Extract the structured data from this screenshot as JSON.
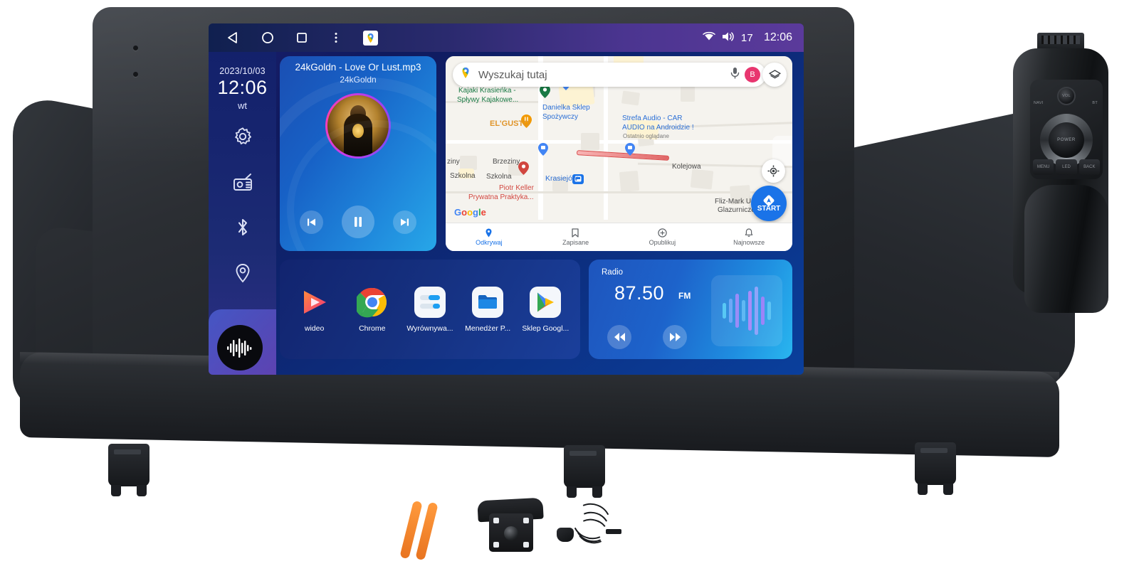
{
  "device": {
    "screen_label": "car-head-unit-screen"
  },
  "statusbar": {
    "nav": [
      {
        "name": "back-icon",
        "label": "Back"
      },
      {
        "name": "home-icon",
        "label": "Home"
      },
      {
        "name": "recents-icon",
        "label": "Recents"
      },
      {
        "name": "overflow-menu-icon",
        "label": "More"
      },
      {
        "name": "maps-shortcut-icon",
        "label": "Maps"
      }
    ],
    "wifi": "wifi-icon",
    "volume_icon": "speaker-icon",
    "volume_value": "17",
    "clock": "12:06"
  },
  "rail": {
    "date": "2023/10/03",
    "time": "12:06",
    "day": "wt",
    "items": [
      {
        "icon": "gear-icon",
        "label": "Settings"
      },
      {
        "icon": "radio-icon",
        "label": "Radio"
      },
      {
        "icon": "bluetooth-icon",
        "label": "Bluetooth"
      },
      {
        "icon": "location-pin-icon",
        "label": "Navigation"
      }
    ],
    "music_button": "music-waveform-icon"
  },
  "music": {
    "title": "24kGoldn - Love Or Lust.mp3",
    "artist": "24kGoldn",
    "prev_icon": "previous-track-icon",
    "play_icon": "pause-icon",
    "next_icon": "next-track-icon",
    "state": "playing"
  },
  "map": {
    "search_placeholder": "Wyszukaj tutaj",
    "mic_icon": "microphone-icon",
    "avatar_initial": "B",
    "layers_icon": "layers-icon",
    "locate_icon": "locate-me-icon",
    "start_label": "START",
    "google_logo": "Google",
    "labels": [
      {
        "text": "Kajaki Krasieńka -",
        "kind": "green"
      },
      {
        "text": "Spływy Kajakowe...",
        "kind": "green"
      },
      {
        "text": "Danielka Sklep",
        "kind": "blue"
      },
      {
        "text": "Spożywczy",
        "kind": "blue"
      },
      {
        "text": "Strefa Audio - CAR",
        "kind": "blue"
      },
      {
        "text": "AUDIO na Androidzie !",
        "kind": "blue"
      },
      {
        "text": "Ostatnio oglądane",
        "kind": "grey"
      },
      {
        "text": "EL'GUSTO",
        "kind": "orange"
      },
      {
        "text": "Brzeziny",
        "kind": "road"
      },
      {
        "text": "ziny",
        "kind": "road"
      },
      {
        "text": "Szkolna",
        "kind": "road"
      },
      {
        "text": "Szkolna",
        "kind": "road"
      },
      {
        "text": "Kolejowa",
        "kind": "road"
      },
      {
        "text": "Krasiejów",
        "kind": "blue"
      },
      {
        "text": "Piotr Keller",
        "kind": "red"
      },
      {
        "text": "Prywatna Praktyka...",
        "kind": "red"
      },
      {
        "text": "Fliz-Mark Usługi",
        "kind": "road"
      },
      {
        "text": "Glazurnicze",
        "kind": "road"
      }
    ],
    "bottom_nav": [
      {
        "label": "Odkrywaj",
        "icon": "explore-pin-icon",
        "active": true
      },
      {
        "label": "Zapisane",
        "icon": "bookmark-icon",
        "active": false
      },
      {
        "label": "Opublikuj",
        "icon": "contribute-plus-icon",
        "active": false
      },
      {
        "label": "Najnowsze",
        "icon": "bell-icon",
        "active": false
      }
    ]
  },
  "apps": [
    {
      "label": "wideo",
      "icon": "video-player-icon"
    },
    {
      "label": "Chrome",
      "icon": "chrome-icon"
    },
    {
      "label": "Wyrównywa...",
      "icon": "equalizer-icon"
    },
    {
      "label": "Menedżer P...",
      "icon": "file-manager-icon"
    },
    {
      "label": "Sklep Googl...",
      "icon": "play-store-icon"
    }
  ],
  "radio": {
    "title": "Radio",
    "frequency": "87.50",
    "band": "FM",
    "prev_icon": "rewind-icon",
    "next_icon": "fast-forward-icon",
    "visualizer_icon": "audio-waveform-icon",
    "bars": [
      22,
      34,
      48,
      30,
      56,
      68,
      40,
      26
    ]
  },
  "remote": {
    "name": "steering-wheel-remote",
    "vol_label": "VOL",
    "navi_label": "NAVI",
    "bt_label": "BT",
    "power_label": "POWER",
    "keys": [
      "MENU",
      "LED",
      "BACK"
    ]
  },
  "accessories": [
    {
      "name": "pry-tools",
      "label": "Pry tools"
    },
    {
      "name": "rear-view-camera",
      "label": "Rear view camera"
    },
    {
      "name": "external-microphone",
      "label": "External microphone"
    }
  ],
  "colors": {
    "accent_blue": "#1a73e8",
    "screen_blue": "#15307f",
    "status_purple": "#5b3a9b",
    "avatar_pink": "#e8366f",
    "orange": "#e87420"
  }
}
